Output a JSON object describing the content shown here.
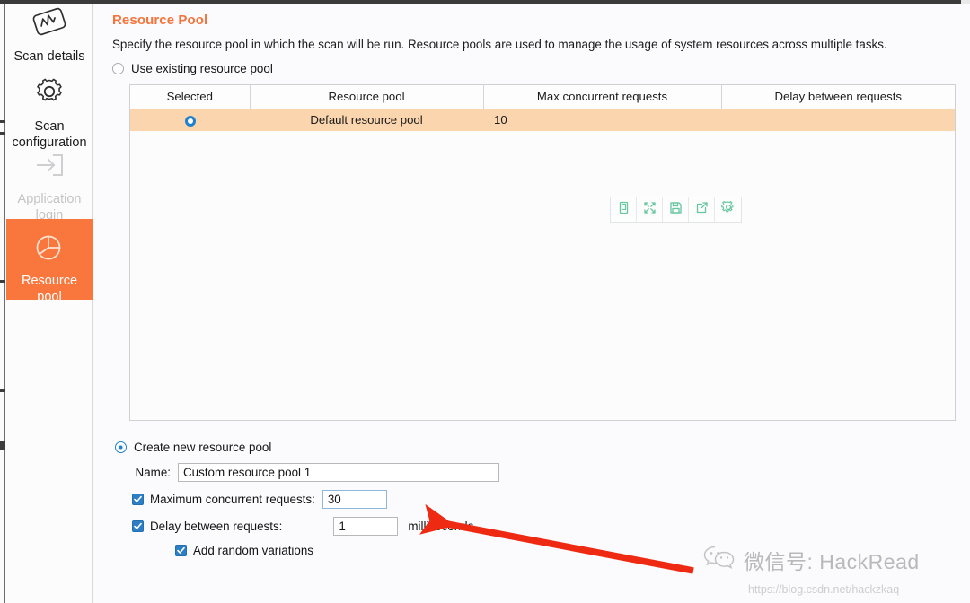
{
  "sidebar": {
    "items": [
      {
        "label": "Scan details",
        "icon": "scan-details-icon",
        "state": "normal"
      },
      {
        "label": "Scan\nconfiguration",
        "icon": "gear-icon",
        "state": "normal"
      },
      {
        "label": "Application\nlogin",
        "icon": "login-arrow-icon",
        "state": "disabled"
      },
      {
        "label": "Resource\npool",
        "icon": "pie-chart-icon",
        "state": "active"
      }
    ],
    "line1": {
      "a": "Scan details",
      "b": "Scan",
      "c": "configuration",
      "d": "Application",
      "e": "login",
      "f": "Resource",
      "g": "pool"
    }
  },
  "page": {
    "title": "Resource Pool",
    "description": "Specify the resource pool in which the scan will be run. Resource pools are used to manage the usage of system resources across multiple tasks."
  },
  "options": {
    "use_existing_label": "Use existing resource pool",
    "use_existing_selected": false,
    "create_new_label": "Create new resource pool",
    "create_new_selected": true
  },
  "table": {
    "headers": {
      "selected": "Selected",
      "resource_pool": "Resource pool",
      "max_concurrent": "Max concurrent requests",
      "delay_between": "Delay between requests"
    },
    "rows": [
      {
        "selected": true,
        "resource_pool": "Default resource pool",
        "max_concurrent": "10",
        "delay_between": ""
      }
    ]
  },
  "toolbar": {
    "buttons": [
      {
        "name": "copy-to-clipboard-icon",
        "label": ""
      },
      {
        "name": "expand-icon",
        "label": ""
      },
      {
        "name": "save-icon",
        "label": ""
      },
      {
        "name": "export-icon",
        "label": ""
      },
      {
        "name": "settings-gear-icon",
        "label": ""
      }
    ]
  },
  "form": {
    "name_label": "Name:",
    "name_value": "Custom resource pool 1",
    "name_placeholder": "Custom resource pool 1",
    "max_requests_label": "Maximum concurrent requests:",
    "max_requests_checked": true,
    "max_requests_value": "30",
    "delay_label": "Delay between requests:",
    "delay_checked": true,
    "delay_value": "1",
    "delay_units": "milliseconds",
    "random_label": "Add random variations",
    "random_checked": true
  },
  "watermark": {
    "text": "微信号: HackRead",
    "url": "https://blog.csdn.net/hackzkaq"
  },
  "colors": {
    "accent_orange": "#f9763d",
    "title_orange": "#f4743b",
    "row_highlight": "#fad5ae",
    "radio_blue": "#1f7fd0",
    "checkbox_blue": "#2c7fc4",
    "toolbar_green": "#65c6a0",
    "annotation_red": "#ee2a12"
  }
}
